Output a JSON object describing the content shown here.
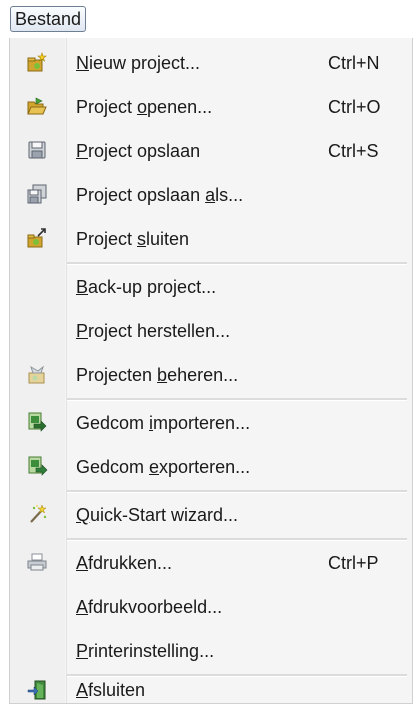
{
  "menu": {
    "title": "Bestand"
  },
  "items": {
    "new": {
      "pre": "",
      "key": "N",
      "post": "ieuw project...",
      "shortcut": "Ctrl+N"
    },
    "open": {
      "pre": "Project ",
      "key": "o",
      "post": "penen...",
      "shortcut": "Ctrl+O"
    },
    "save": {
      "pre": "",
      "key": "P",
      "post": "roject opslaan",
      "shortcut": "Ctrl+S"
    },
    "saveas": {
      "pre": "Project opslaan ",
      "key": "a",
      "post": "ls..."
    },
    "close": {
      "pre": "Project ",
      "key": "s",
      "post": "luiten"
    },
    "backup": {
      "pre": "",
      "key": "B",
      "post": "ack-up project..."
    },
    "restore": {
      "pre": "",
      "key": "P",
      "post": "roject herstellen..."
    },
    "manage": {
      "pre": "Projecten ",
      "key": "b",
      "post": "eheren..."
    },
    "import": {
      "pre": "Gedcom ",
      "key": "i",
      "post": "mporteren..."
    },
    "export": {
      "pre": "Gedcom ",
      "key": "e",
      "post": "xporteren..."
    },
    "wizard": {
      "pre": "",
      "key": "Q",
      "post": "uick-Start wizard..."
    },
    "print": {
      "pre": "",
      "key": "A",
      "post": "fdrukken...",
      "shortcut": "Ctrl+P"
    },
    "preview": {
      "pre": "",
      "key": "A",
      "post": "fdrukvoorbeeld..."
    },
    "printer": {
      "pre": "",
      "key": "P",
      "post": "rinterinstelling..."
    },
    "exit": {
      "pre": "",
      "key": "A",
      "post": "fsluiten"
    }
  },
  "icons": {
    "new": "new-project-icon",
    "open": "open-project-icon",
    "save": "save-icon",
    "saveas": "save-as-icon",
    "close": "close-project-icon",
    "manage": "manage-projects-icon",
    "import": "gedcom-import-icon",
    "export": "gedcom-export-icon",
    "wizard": "wizard-wand-icon",
    "print": "printer-icon",
    "exit": "exit-door-icon"
  }
}
